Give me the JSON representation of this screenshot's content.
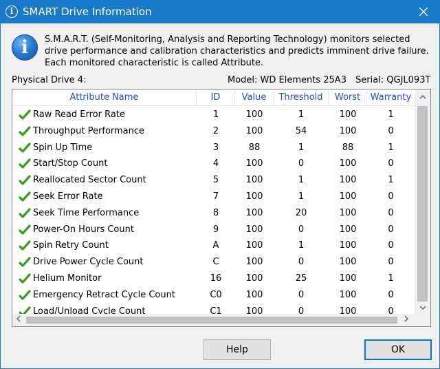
{
  "window": {
    "title": "SMART Drive Information",
    "title_icon": "info-icon",
    "close_icon": "close-icon"
  },
  "description": "S.M.A.R.T. (Self-Monitoring, Analysis and Reporting Technology) monitors selected drive performance and calibration characteristics and predicts imminent drive failure. Each monitored characteristic is called Attribute.",
  "drive": {
    "label": "Physical Drive 4:",
    "model": "Model: WD Elements 25A3",
    "serial": "Serial: QGJL093T"
  },
  "columns": [
    "Attribute Name",
    "ID",
    "Value",
    "Threshold",
    "Worst",
    "Warranty"
  ],
  "rows": [
    {
      "name": "Raw Read Error Rate",
      "id": "1",
      "value": "100",
      "threshold": "1",
      "worst": "100",
      "warranty": "1"
    },
    {
      "name": "Throughput Performance",
      "id": "2",
      "value": "100",
      "threshold": "54",
      "worst": "100",
      "warranty": "0"
    },
    {
      "name": "Spin Up Time",
      "id": "3",
      "value": "88",
      "threshold": "1",
      "worst": "88",
      "warranty": "1"
    },
    {
      "name": "Start/Stop Count",
      "id": "4",
      "value": "100",
      "threshold": "0",
      "worst": "100",
      "warranty": "0"
    },
    {
      "name": "Reallocated Sector Count",
      "id": "5",
      "value": "100",
      "threshold": "1",
      "worst": "100",
      "warranty": "1"
    },
    {
      "name": "Seek Error Rate",
      "id": "7",
      "value": "100",
      "threshold": "1",
      "worst": "100",
      "warranty": "0"
    },
    {
      "name": "Seek Time Performance",
      "id": "8",
      "value": "100",
      "threshold": "20",
      "worst": "100",
      "warranty": "0"
    },
    {
      "name": "Power-On Hours Count",
      "id": "9",
      "value": "100",
      "threshold": "0",
      "worst": "100",
      "warranty": "0"
    },
    {
      "name": "Spin Retry Count",
      "id": "A",
      "value": "100",
      "threshold": "1",
      "worst": "100",
      "warranty": "0"
    },
    {
      "name": "Drive Power Cycle Count",
      "id": "C",
      "value": "100",
      "threshold": "0",
      "worst": "100",
      "warranty": "0"
    },
    {
      "name": "Helium Monitor",
      "id": "16",
      "value": "100",
      "threshold": "25",
      "worst": "100",
      "warranty": "1"
    },
    {
      "name": "Emergency Retract Cycle Count",
      "id": "C0",
      "value": "100",
      "threshold": "0",
      "worst": "100",
      "warranty": "0"
    },
    {
      "name": "Load/Unload Cycle Count",
      "id": "C1",
      "value": "100",
      "threshold": "0",
      "worst": "100",
      "warranty": "0"
    }
  ],
  "row_status_icon": "green-checkmark-icon",
  "buttons": {
    "help": "Help",
    "ok": "OK"
  },
  "colors": {
    "titlebar": "#1979ca",
    "header_text": "#1c4fd8",
    "check": "#3a9a1a"
  }
}
